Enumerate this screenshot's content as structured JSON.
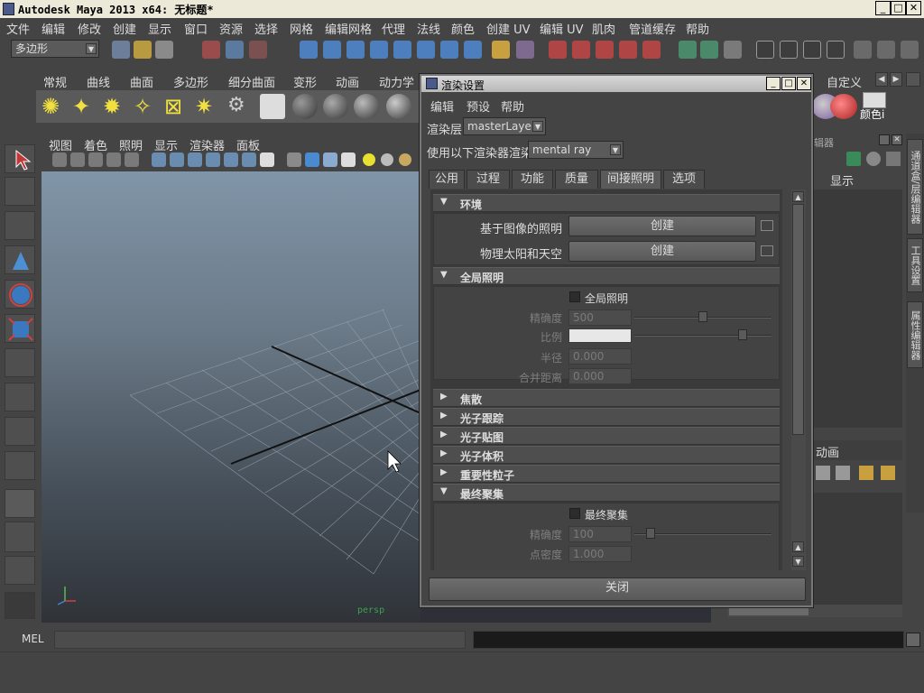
{
  "window": {
    "title": "Autodesk Maya 2013 x64: 无标题*",
    "minimize": "_",
    "maximize": "□",
    "close": "✕"
  },
  "menubar": [
    "文件",
    "编辑",
    "修改",
    "创建",
    "显示",
    "窗口",
    "资源",
    "选择",
    "网格",
    "编辑网格",
    "代理",
    "法线",
    "颜色",
    "创建 UV",
    "编辑 UV",
    "肌肉",
    "管道缓存",
    "帮助"
  ],
  "statusline": {
    "mode": "多边形"
  },
  "shelf_tabs": [
    "常规",
    "曲线",
    "曲面",
    "多边形",
    "细分曲面",
    "变形",
    "动画",
    "动力学"
  ],
  "shelf_right": {
    "tab": "自定义",
    "label": "颜色i"
  },
  "viewport": {
    "menu": [
      "视图",
      "着色",
      "照明",
      "显示",
      "渲染器",
      "面板"
    ],
    "camera_label": "persp"
  },
  "right_panel": {
    "header": "辑器",
    "display_label": "显示",
    "anim_tab": "动画",
    "vertical_tabs": [
      "通道盒/层编辑器",
      "工具设置",
      "属性编辑器"
    ]
  },
  "cmdline": {
    "label": "MEL"
  },
  "dialog": {
    "title": "渲染设置",
    "menu": [
      "编辑",
      "预设",
      "帮助"
    ],
    "render_layer_label": "渲染层",
    "render_layer_value": "masterLayer",
    "renderer_label": "使用以下渲染器渲染",
    "renderer_value": "mental ray",
    "tabs": [
      "公用",
      "过程",
      "功能",
      "质量",
      "间接照明",
      "选项"
    ],
    "active_tab": "间接照明",
    "sections": {
      "env": {
        "title": "环境",
        "ibl_label": "基于图像的照明",
        "ibl_button": "创建",
        "sky_label": "物理太阳和天空",
        "sky_button": "创建"
      },
      "gi": {
        "title": "全局照明",
        "checkbox_label": "全局照明",
        "accuracy_label": "精确度",
        "accuracy_value": "500",
        "scale_label": "比例",
        "radius_label": "半径",
        "radius_value": "0.000",
        "merge_label": "合并距离",
        "merge_value": "0.000"
      },
      "collapsed": [
        "焦散",
        "光子跟踪",
        "光子贴图",
        "光子体积",
        "重要性粒子"
      ],
      "fg": {
        "title": "最终聚集",
        "checkbox_label": "最终聚集",
        "accuracy_label": "精确度",
        "accuracy_value": "100",
        "density_label": "点密度",
        "density_value": "1.000"
      }
    },
    "close_button": "关闭"
  },
  "colors": {
    "panel": "#444444",
    "dialog_title": "#c8c8c8",
    "accent": "#e7e7e7"
  }
}
